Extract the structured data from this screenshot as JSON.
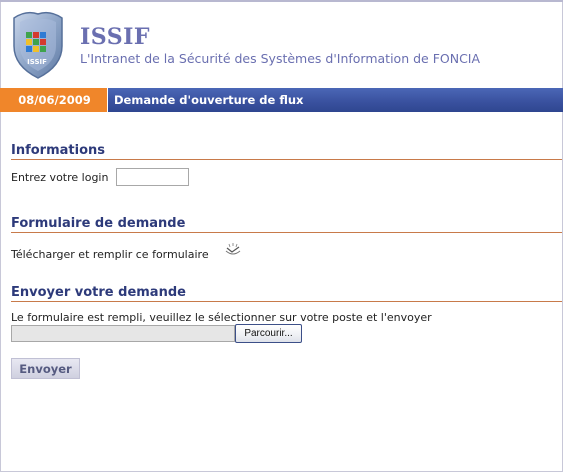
{
  "header": {
    "site_name": "ISSIF",
    "subtitle": "L'Intranet de la Sécurité des Systèmes d'Information de FONCIA",
    "logo_text": "ISSIF"
  },
  "title_bar": {
    "date": "08/06/2009",
    "page_title": "Demande d'ouverture de flux"
  },
  "sections": {
    "informations": {
      "heading": "Informations",
      "login_label": "Entrez votre login",
      "login_value": ""
    },
    "formulaire": {
      "heading": "Formulaire de demande",
      "download_text": "Télécharger et remplir ce formulaire",
      "download_icon": "download-form-icon"
    },
    "envoyer": {
      "heading": "Envoyer votre demande",
      "instructions": "Le formulaire est rempli, veuillez le sélectionner sur votre poste et l'envoyer",
      "file_value": "",
      "browse_label": "Parcourir...",
      "submit_label": "Envoyer"
    }
  },
  "colors": {
    "brand": "#6a6fb0",
    "date_bg": "#f0862a",
    "title_bar_bg": "#3a52a0",
    "heading": "#2d3a7a",
    "heading_rule": "#c87a4a"
  }
}
